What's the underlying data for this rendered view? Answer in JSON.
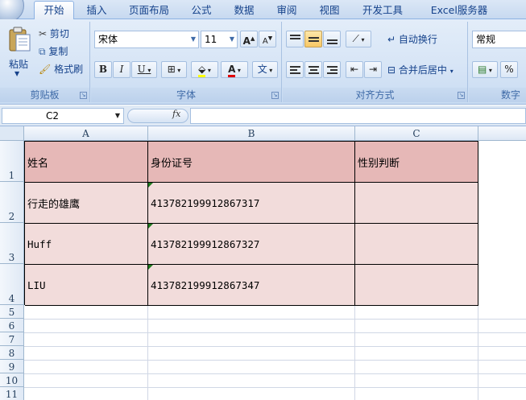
{
  "tabs": [
    "开始",
    "插入",
    "页面布局",
    "公式",
    "数据",
    "审阅",
    "视图",
    "开发工具",
    "Excel服务器"
  ],
  "clipboard": {
    "paste": "粘贴",
    "cut": "剪切",
    "copy": "复制",
    "format_painter": "格式刷",
    "title": "剪贴板"
  },
  "font": {
    "name": "宋体",
    "size": "11",
    "title": "字体",
    "bold": "B",
    "italic": "I",
    "underline": "U",
    "font_color": "A",
    "phonetic": "文"
  },
  "alignment": {
    "wrap_text": "自动换行",
    "merge_center": "合并后居中",
    "title": "对齐方式"
  },
  "number": {
    "format": "常规",
    "percent": "%",
    "title": "数字"
  },
  "formula_bar": {
    "name_box": "C2",
    "fx": "fx",
    "content": ""
  },
  "columns": [
    "A",
    "B",
    "C"
  ],
  "rows": [
    "1",
    "2",
    "3",
    "4",
    "5",
    "6",
    "7",
    "8",
    "9",
    "10",
    "11"
  ],
  "table": {
    "headers": [
      "姓名",
      "身份证号",
      "性别判断"
    ],
    "records": [
      [
        "行走的雄鹰",
        "413782199912867317",
        ""
      ],
      [
        "Huff",
        "413782199912867327",
        ""
      ],
      [
        "LIU",
        "413782199912867347",
        ""
      ]
    ]
  },
  "colors": {
    "header_fill": "#e6b8b7",
    "body_fill": "#f2dcdb",
    "text_marker": "#1e7a1e"
  }
}
